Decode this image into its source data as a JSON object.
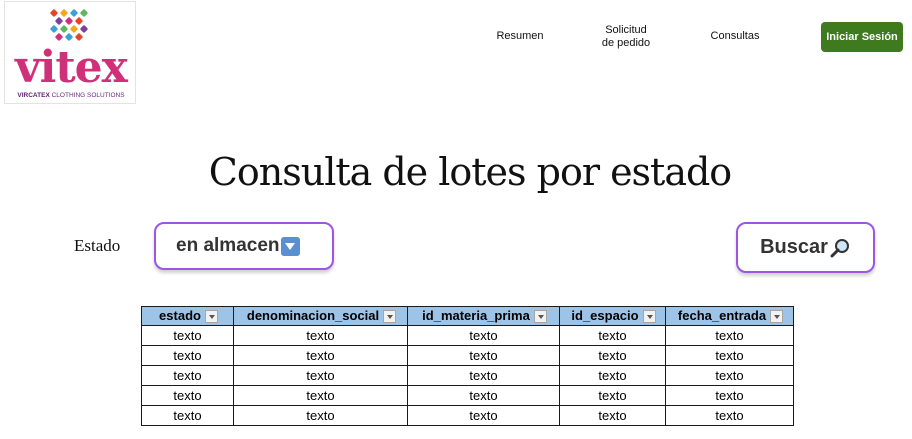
{
  "logo": {
    "word": "vitex",
    "tagline_bold": "VIRCATEX",
    "tagline_rest": "CLOTHING SOLUTIONS",
    "colors": [
      "#e8442a",
      "#f2a81d",
      "#3aa0d8",
      "#7b3fa0",
      "#d0307a",
      "#5cb85c"
    ]
  },
  "nav": {
    "resumen": "Resumen",
    "solicitud_line1": "Solicitud",
    "solicitud_line2": "de pedido",
    "consultas": "Consultas",
    "login_label": "Iniciar Sesión"
  },
  "page": {
    "title": "Consulta de lotes por estado"
  },
  "filter": {
    "label": "Estado",
    "selected_value": "en almacen",
    "search_label": "Buscar"
  },
  "table": {
    "headers": [
      "estado",
      "denominacion_social",
      "id_materia_prima",
      "id_espacio",
      "fecha_entrada"
    ],
    "rows": [
      [
        "texto",
        "texto",
        "texto",
        "texto",
        "texto"
      ],
      [
        "texto",
        "texto",
        "texto",
        "texto",
        "texto"
      ],
      [
        "texto",
        "texto",
        "texto",
        "texto",
        "texto"
      ],
      [
        "texto",
        "texto",
        "texto",
        "texto",
        "texto"
      ],
      [
        "texto",
        "texto",
        "texto",
        "texto",
        "texto"
      ]
    ]
  },
  "colors": {
    "accent_border": "#9d55e8",
    "login_button": "#3f7a1f",
    "table_header": "#9dc3e6",
    "brand_pink": "#d0307a"
  }
}
